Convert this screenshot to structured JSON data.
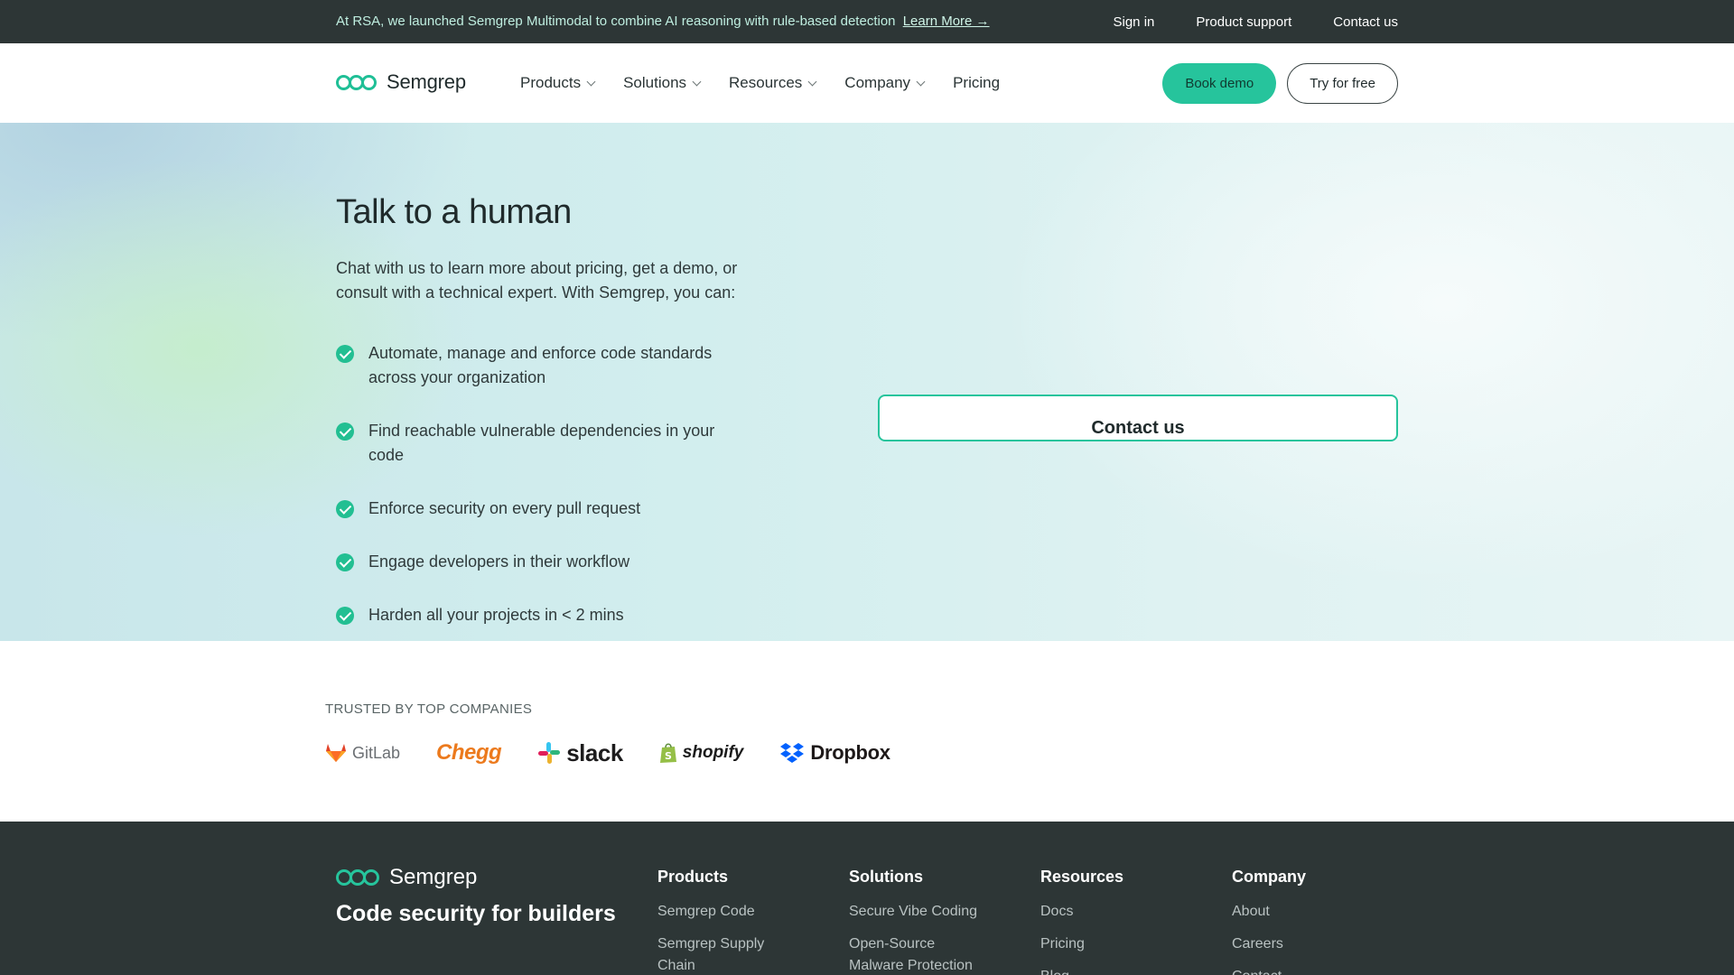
{
  "announcement": {
    "message": "At RSA, we launched Semgrep Multimodal to combine AI reasoning with rule-based detection",
    "link": "Learn More →",
    "links": [
      "Sign in",
      "Product support",
      "Contact us"
    ]
  },
  "header": {
    "brand": "Semgrep",
    "nav": [
      {
        "label": "Products",
        "dropdown": true
      },
      {
        "label": "Solutions",
        "dropdown": true
      },
      {
        "label": "Resources",
        "dropdown": true
      },
      {
        "label": "Company",
        "dropdown": true
      },
      {
        "label": "Pricing",
        "dropdown": false
      }
    ],
    "book_demo": "Book demo",
    "try_free": "Try for free"
  },
  "hero": {
    "title": "Talk to a human",
    "intro": "Chat with us to learn more about pricing, get a demo, or consult with a technical expert. With Semgrep, you can:",
    "benefits": [
      "Automate, manage and enforce code standards across your organization",
      "Find reachable vulnerable dependencies in your code",
      "Enforce security on every pull request",
      "Engage developers in their workflow",
      "Harden all your projects in < 2 mins"
    ],
    "contact_button": "Contact us"
  },
  "trusted": {
    "heading": "TRUSTED BY TOP COMPANIES",
    "logos": [
      "GitLab",
      "Chegg",
      "slack",
      "shopify",
      "Dropbox"
    ]
  },
  "footer": {
    "brand": "Semgrep",
    "tagline": "Code security for builders",
    "columns": [
      {
        "title": "Products",
        "links": [
          "Semgrep Code",
          "Semgrep Supply Chain"
        ]
      },
      {
        "title": "Solutions",
        "links": [
          "Secure Vibe Coding",
          "Open-Source Malware Protection"
        ]
      },
      {
        "title": "Resources",
        "links": [
          "Docs",
          "Pricing",
          "Blog"
        ]
      },
      {
        "title": "Company",
        "links": [
          "About",
          "Careers",
          "Contact"
        ]
      }
    ]
  },
  "colors": {
    "accent": "#26c49c",
    "dark": "#2d3636"
  }
}
